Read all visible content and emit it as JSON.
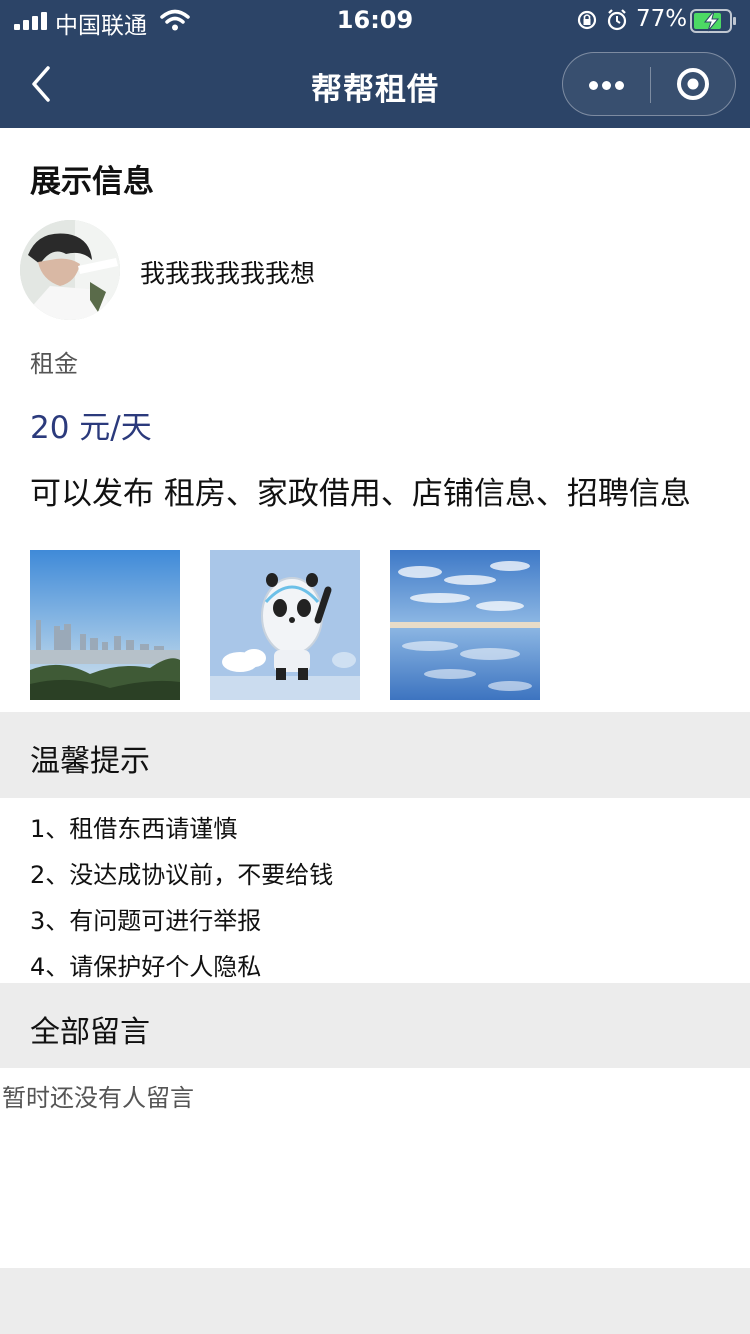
{
  "status_bar": {
    "carrier": "中国联通",
    "time": "16:09",
    "battery": "77%"
  },
  "nav": {
    "title": "帮帮租借"
  },
  "display_info": {
    "title": "展示信息",
    "username": "我我我我我我想",
    "rent_label": "租金",
    "rent_value": "20 元/天",
    "description": "可以发布 租房、家政借用、店铺信息、招聘信息"
  },
  "tips": {
    "title": "温馨提示",
    "items": [
      "1、租借东西请谨慎",
      "2、没达成协议前，不要给钱",
      "3、有问题可进行举报",
      "4、请保护好个人隐私"
    ]
  },
  "comments": {
    "title": "全部留言",
    "empty_text": "暂时还没有人留言"
  },
  "colors": {
    "nav_bg": "#2c4467",
    "rent_value": "#2b3a7c",
    "band_bg": "#ececec"
  }
}
